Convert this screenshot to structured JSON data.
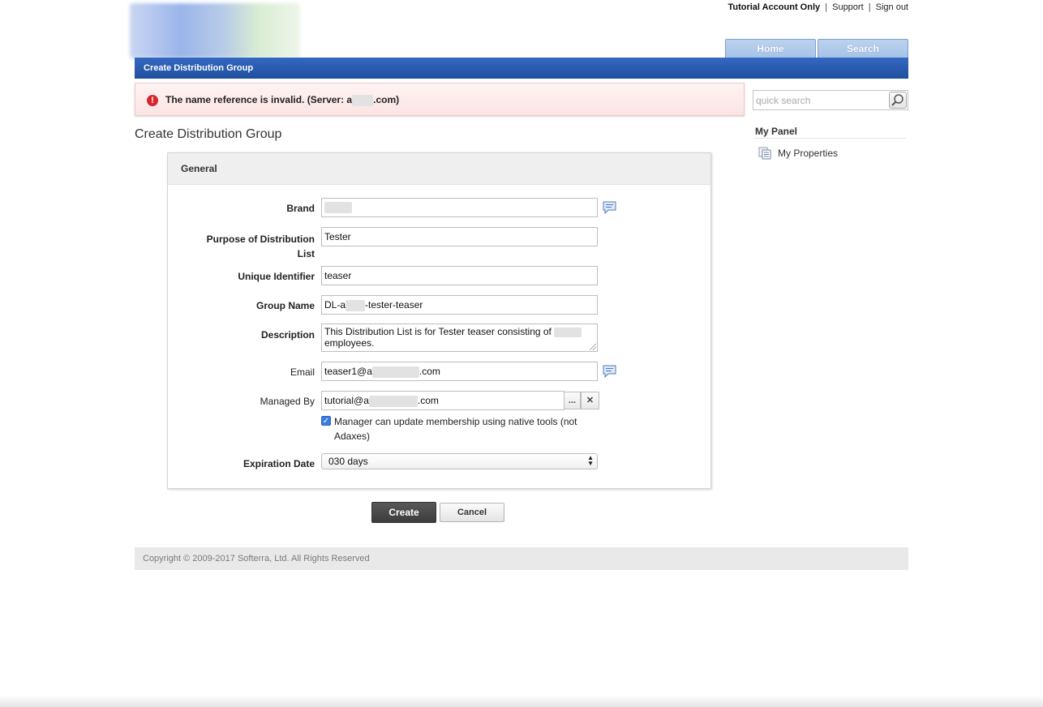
{
  "header": {
    "account": "Tutorial Account Only",
    "separator": "|",
    "support": "Support",
    "signout": "Sign out"
  },
  "tabs": {
    "home": "Home",
    "search": "Search"
  },
  "titlebar": "Create Distribution Group",
  "error": {
    "prefix": "The name reference is invalid. (Server: a",
    "suffix": ".com)"
  },
  "quick_search": {
    "placeholder": "quick search"
  },
  "panel": {
    "title": "My Panel",
    "my_properties": "My Properties"
  },
  "page_heading": "Create Distribution Group",
  "form": {
    "section": "General",
    "brand": {
      "label": "Brand",
      "value": ""
    },
    "purpose": {
      "label_line1": "Purpose of Distribution",
      "label_line2": "List",
      "value": "Tester"
    },
    "unique_id": {
      "label": "Unique Identifier",
      "value": "teaser"
    },
    "group_name": {
      "label": "Group Name",
      "prefix": "DL-a",
      "suffix": "-tester-teaser"
    },
    "description": {
      "label": "Description",
      "line1": "This Distribution List is for Tester teaser consisting of",
      "line2": "employees."
    },
    "email": {
      "label": "Email",
      "prefix": "teaser1@a",
      "suffix": ".com"
    },
    "managed_by": {
      "label": "Managed By",
      "prefix": "tutorial@a",
      "suffix": ".com",
      "browse": "...",
      "clear": "✕"
    },
    "manager_checkbox": {
      "label": "Manager can update membership using native tools (not Adaxes)",
      "checked": true
    },
    "expiration": {
      "label": "Expiration Date",
      "value": "030 days"
    }
  },
  "buttons": {
    "create": "Create",
    "cancel": "Cancel"
  },
  "footer": "Copyright © 2009-2017 Softerra, Ltd. All Rights Reserved",
  "colors": {
    "titlebar": "#1f4f9e",
    "error_bg": "#fbe3e3",
    "error_icon": "#d6262b",
    "create_btn": "#3c3c3c"
  }
}
